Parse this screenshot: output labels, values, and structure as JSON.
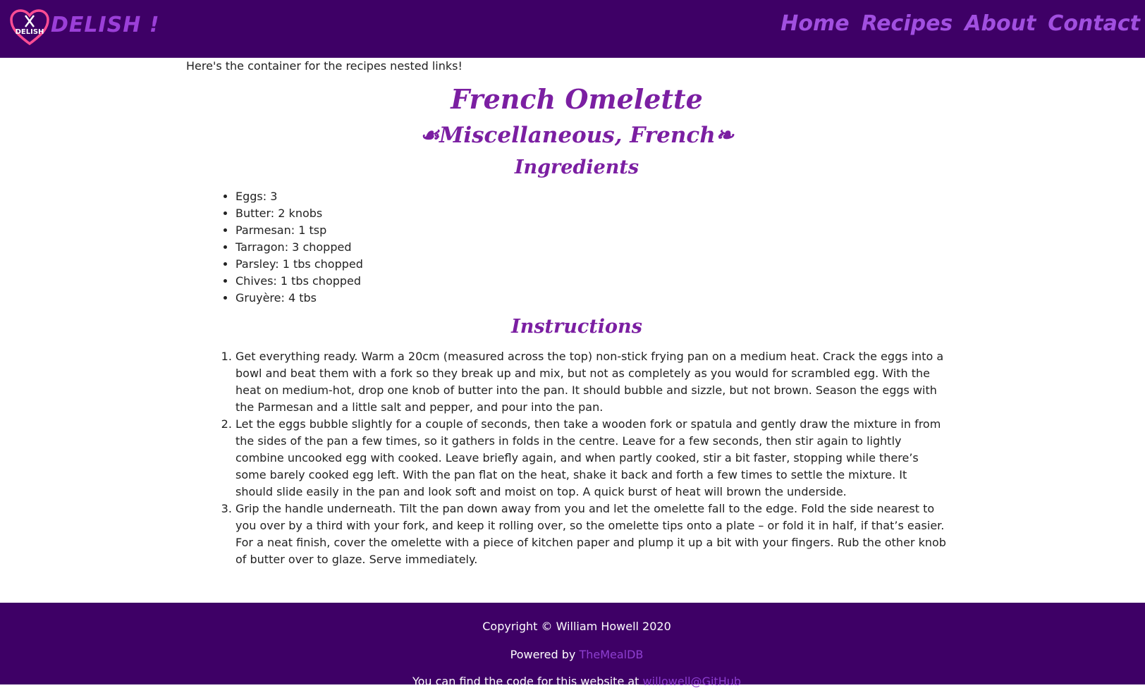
{
  "header": {
    "logo_text": "DELISH",
    "brand": "DELISH !",
    "nav": [
      "Home",
      "Recipes",
      "About",
      "Contact"
    ]
  },
  "intro": "Here's the container for the recipes nested links!",
  "recipe": {
    "title": "French Omelette",
    "subtitle": "☙Miscellaneous, French❧",
    "ingredients_heading": "Ingredients",
    "ingredients": [
      "Eggs: 3",
      "Butter: 2 knobs",
      "Parmesan: 1 tsp",
      "Tarragon: 3 chopped",
      "Parsley: 1 tbs chopped",
      "Chives: 1 tbs chopped",
      "Gruyère: 4 tbs"
    ],
    "instructions_heading": "Instructions",
    "instructions": [
      "Get everything ready. Warm a 20cm (measured across the top) non-stick frying pan on a medium heat. Crack the eggs into a bowl and beat them with a fork so they break up and mix, but not as completely as you would for scrambled egg. With the heat on medium-hot, drop one knob of butter into the pan. It should bubble and sizzle, but not brown. Season the eggs with the Parmesan and a little salt and pepper, and pour into the pan.",
      "Let the eggs bubble slightly for a couple of seconds, then take a wooden fork or spatula and gently draw the mixture in from the sides of the pan a few times, so it gathers in folds in the centre. Leave for a few seconds, then stir again to lightly combine uncooked egg with cooked. Leave briefly again, and when partly cooked, stir a bit faster, stopping while there’s some barely cooked egg left. With the pan flat on the heat, shake it back and forth a few times to settle the mixture. It should slide easily in the pan and look soft and moist on top. A quick burst of heat will brown the underside.",
      "Grip the handle underneath. Tilt the pan down away from you and let the omelette fall to the edge. Fold the side nearest to you over by a third with your fork, and keep it rolling over, so the omelette tips onto a plate – or fold it in half, if that’s easier. For a neat finish, cover the omelette with a piece of kitchen paper and plump it up a bit with your fingers. Rub the other knob of butter over to glaze. Serve immediately."
    ]
  },
  "footer": {
    "copyright": "Copyright © William Howell 2020",
    "powered_prefix": "Powered by ",
    "powered_link": "TheMealDB",
    "code_prefix": "You can find the code for this website at ",
    "code_link": "willowell@GitHub"
  },
  "colors": {
    "header_bg": "#3e0066",
    "accent": "#7b1fa2",
    "nav_text": "#a14fe0"
  }
}
